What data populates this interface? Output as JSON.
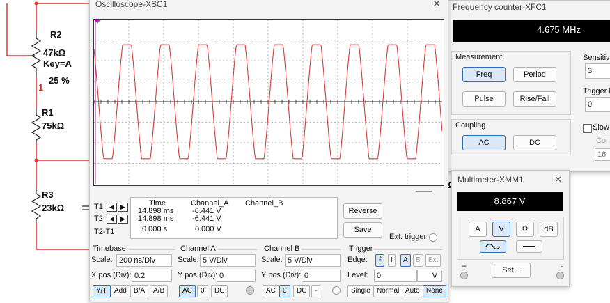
{
  "circuit": {
    "r2_name": "R2",
    "r2_value": "47kΩ",
    "r2_key": "Key=A",
    "r2_percent": "25 %",
    "node_label": "1",
    "r1_name": "R1",
    "r1_value": "75kΩ",
    "r3_name": "R3",
    "r3_value": "23kΩ",
    "partial_label": "kΩ"
  },
  "oscilloscope": {
    "title": "Oscilloscope-XSC1",
    "waveform": {
      "cycles": 9,
      "color": "#d63a3a"
    },
    "cursor_table": {
      "headers": [
        "Time",
        "Channel_A",
        "Channel_B"
      ],
      "rows": [
        {
          "label": "T1",
          "time": "14.898 ms",
          "a": "-6.441 V",
          "b": ""
        },
        {
          "label": "T2",
          "time": "14.898 ms",
          "a": "-6.441 V",
          "b": ""
        },
        {
          "label": "T2-T1",
          "time": "0.000 s",
          "a": "0.000 V",
          "b": ""
        }
      ]
    },
    "reverse_label": "Reverse",
    "save_label": "Save",
    "ext_trigger_label": "Ext. trigger",
    "timebase": {
      "title": "Timebase",
      "scale_label": "Scale:",
      "scale_value": "200 ns/Div",
      "xpos_label": "X pos.(Div):",
      "xpos_value": "0.2",
      "modes": [
        "Y/T",
        "Add",
        "B/A",
        "A/B"
      ]
    },
    "channel_a": {
      "title": "Channel A",
      "scale_label": "Scale:",
      "scale_value": "5  V/Div",
      "ypos_label": "Y pos.(Div):",
      "ypos_value": "0",
      "coupling": [
        "AC",
        "0",
        "DC"
      ]
    },
    "channel_b": {
      "title": "Channel B",
      "scale_label": "Scale:",
      "scale_value": "5  V/Div",
      "ypos_label": "Y pos.(Div):",
      "ypos_value": "0",
      "coupling": [
        "AC",
        "0",
        "DC",
        "-"
      ]
    },
    "trigger": {
      "title": "Trigger",
      "edge_label": "Edge:",
      "edge_options": [
        "⨍",
        "ʇ",
        "A",
        "B",
        "Ext"
      ],
      "level_label": "Level:",
      "level_value": "0",
      "level_unit": "V",
      "modes": [
        "Single",
        "Normal",
        "Auto",
        "None"
      ]
    }
  },
  "freq_counter": {
    "title": "Frequency counter-XFC1",
    "display": "4.675 MHz",
    "measurement_title": "Measurement",
    "buttons": [
      "Freq",
      "Period",
      "Pulse",
      "Rise/Fall"
    ],
    "coupling_title": "Coupling",
    "coupling": [
      "AC",
      "DC"
    ],
    "sensitivity_title": "Sensitivit",
    "sensitivity_value": "3",
    "trigger_title": "Trigger l",
    "trigger_value": "0",
    "slow_label": "Slow",
    "com_label": "Com",
    "sixteen": "16"
  },
  "multimeter": {
    "title": "Multimeter-XMM1",
    "display": "8.867 V",
    "modes": [
      "A",
      "V",
      "Ω",
      "dB"
    ],
    "set_label": "Set...",
    "plus": "+",
    "minus": "-"
  }
}
